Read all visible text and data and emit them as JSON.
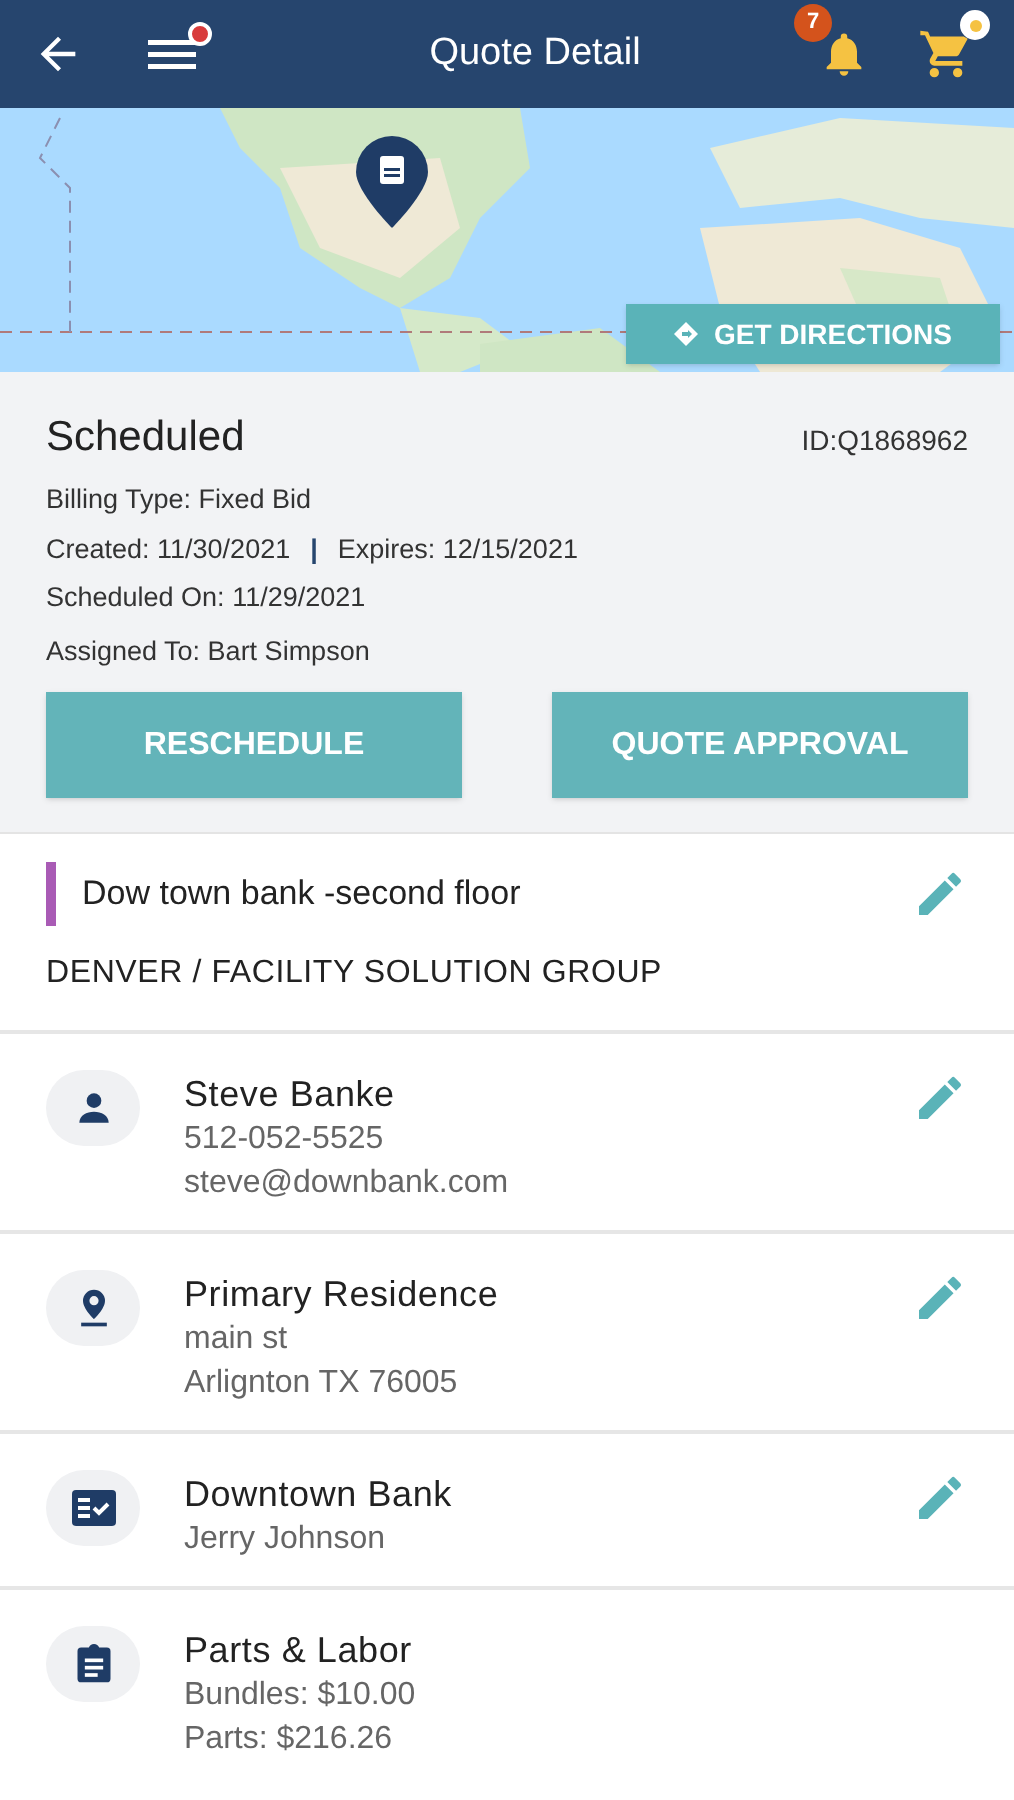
{
  "header": {
    "title": "Quote Detail",
    "notification_count": "7",
    "menu_has_alert": true,
    "cart_has_alert": true
  },
  "map": {
    "kind": "picture",
    "button": "GET DIRECTIONS"
  },
  "summary": {
    "status": "Scheduled",
    "id": "ID:Q1868962",
    "billing": "Billing Type: Fixed Bid",
    "created": "Created: 11/30/2021",
    "separator": "|",
    "expires": "Expires: 12/15/2021",
    "scheduled_on": "Scheduled On: 11/29/2021",
    "assigned": "Assigned To: Bart Simpson",
    "buttons": [
      "RESCHEDULE",
      "QUOTE APPROVAL"
    ]
  },
  "location": {
    "title": "Dow town bank -second floor",
    "color": "#a95bb5",
    "group": "DENVER / FACILITY SOLUTION GROUP",
    "editable": true
  },
  "cards": [
    {
      "kind": "person",
      "title": "Steve Banke",
      "lines": [
        "512-052-5525",
        "steve@downbank.com"
      ],
      "editable": true
    },
    {
      "kind": "location",
      "title": "Primary Residence",
      "lines": [
        "main st",
        "Arlignton TX 76005"
      ],
      "editable": true
    },
    {
      "kind": "checklist",
      "title": "Downtown Bank",
      "lines": [
        "Jerry Johnson"
      ],
      "editable": true
    },
    {
      "kind": "clipboard",
      "title": "Parts & Labor",
      "lines": [
        "Bundles: $10.00",
        "Parts: $216.26"
      ],
      "editable": false
    }
  ]
}
